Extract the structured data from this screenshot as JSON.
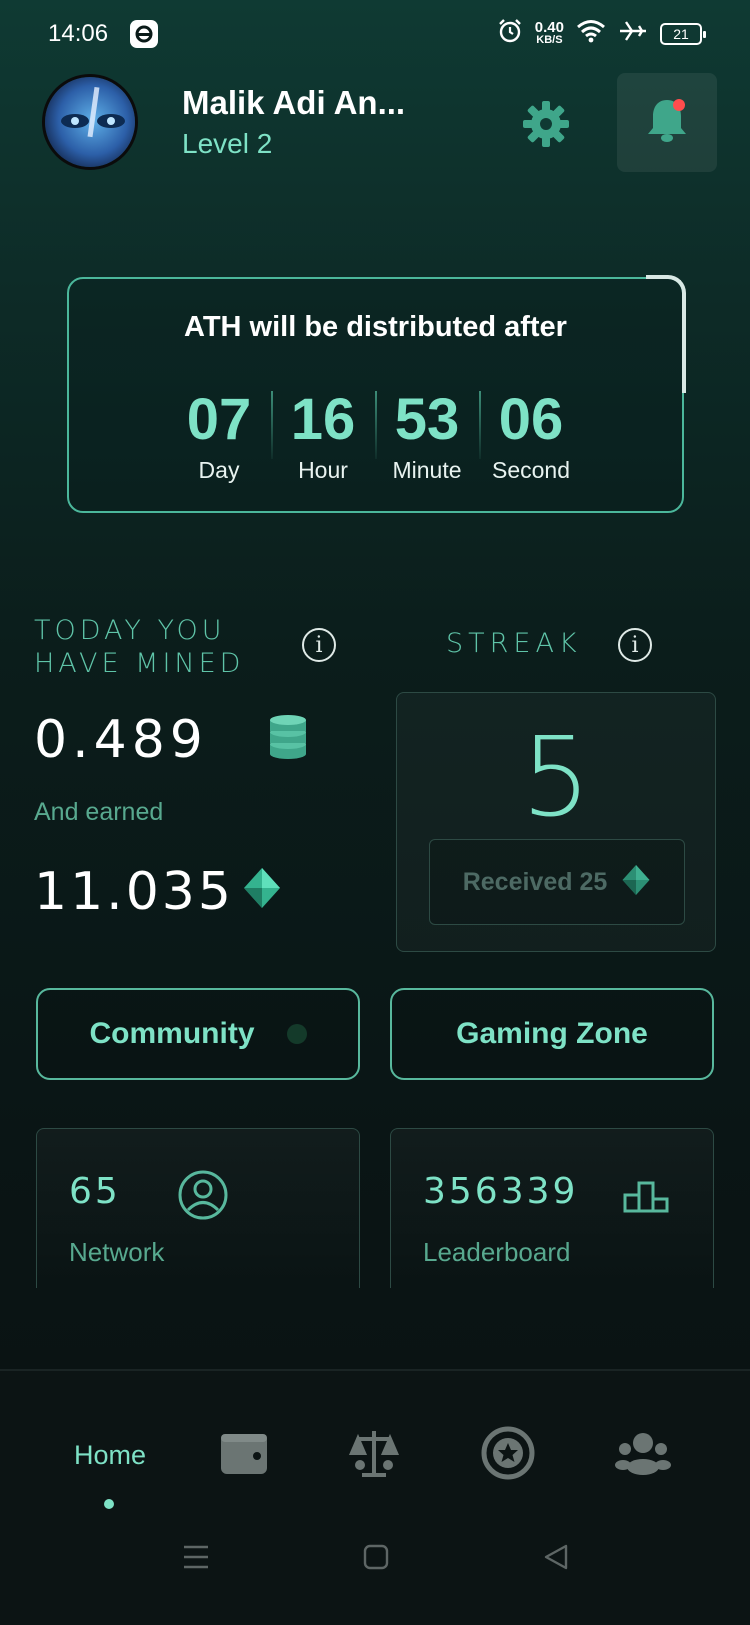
{
  "status_bar": {
    "time": "14:06",
    "speed_value": "0.40",
    "speed_unit": "KB/S",
    "battery": "21"
  },
  "profile": {
    "name": "Malik Adi An...",
    "level": "Level 2"
  },
  "countdown": {
    "title": "ATH will be distributed after",
    "units": [
      {
        "value": "07",
        "label": "Day"
      },
      {
        "value": "16",
        "label": "Hour"
      },
      {
        "value": "53",
        "label": "Minute"
      },
      {
        "value": "06",
        "label": "Second"
      }
    ]
  },
  "mining": {
    "title_line1": "Today you",
    "title_line2": "have mined",
    "mined_value": "0.489",
    "earned_label": "And earned",
    "earned_value": "11.035"
  },
  "streak": {
    "title": "STREAK",
    "value": "5",
    "received_label": "Received 25"
  },
  "actions": {
    "community": "Community",
    "gaming_zone": "Gaming Zone"
  },
  "stats": {
    "network_value": "65",
    "network_label": "Network",
    "leaderboard_value": "356339",
    "leaderboard_label": "Leaderboard"
  },
  "bottom_nav": {
    "home": "Home",
    "items": [
      "wallet-icon",
      "scales-icon",
      "star-badge-icon",
      "people-icon"
    ]
  },
  "colors": {
    "accent": "#7ee2c6",
    "accent_dim": "#58a98f",
    "notification": "#ff4d4d"
  }
}
